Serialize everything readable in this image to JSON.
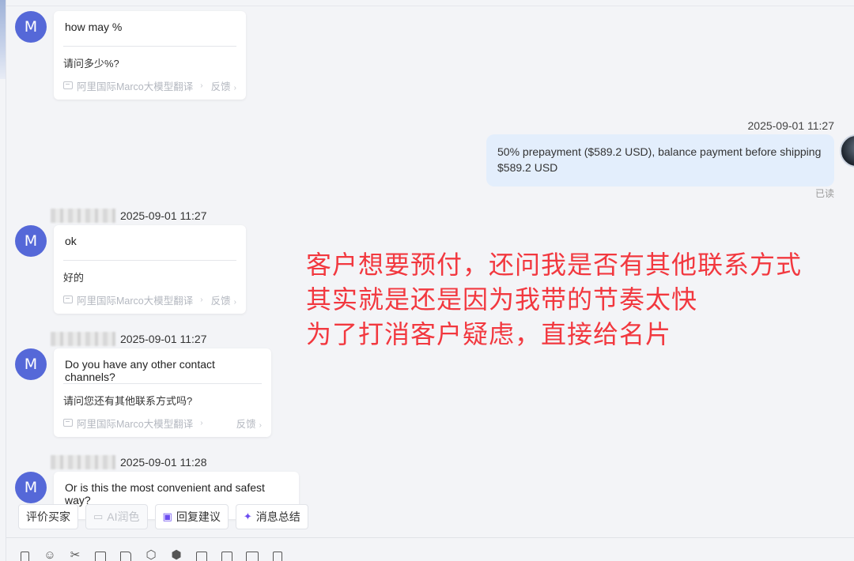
{
  "messages_in": [
    {
      "avatar": "M",
      "original": "how may %",
      "translation": "请问多少%?",
      "translator": "阿里国际Marco大模型翻译",
      "feedback": "反馈"
    },
    {
      "avatar": "M",
      "time": "2025-09-01 11:27",
      "original": "ok",
      "translation": "好的",
      "translator": "阿里国际Marco大模型翻译",
      "feedback": "反馈"
    },
    {
      "avatar": "M",
      "time": "2025-09-01 11:27",
      "original": "Do you have any other contact channels?",
      "translation": "请问您还有其他联系方式吗?",
      "translator": "阿里国际Marco大模型翻译",
      "feedback": "反馈"
    },
    {
      "avatar": "M",
      "time": "2025-09-01 11:28",
      "original": "Or is this the most convenient and safest way?"
    }
  ],
  "message_out": {
    "time": "2025-09-01 11:27",
    "text": "50% prepayment ($589.2 USD), balance payment before shipping $589.2 USD",
    "status": "已读"
  },
  "annotation": [
    "客户想要预付，还问我是否有其他联系方式",
    "其实就是还是因为我带的节奏太快",
    "为了打消客户疑虑，直接给名片"
  ],
  "actions": {
    "rate_buyer": "评价买家",
    "ai_polish": "AI润色",
    "reply_suggest": "回复建议",
    "msg_summary": "消息总结"
  },
  "toolbar_icons": [
    "copy-icon",
    "emoji-icon",
    "scissors-icon",
    "image-icon",
    "folder-icon",
    "product-icon",
    "package-icon",
    "calendar-icon",
    "translate-icon",
    "card-icon",
    "note-icon"
  ],
  "colors": {
    "avatar": "#5568d8",
    "annotation": "#f2383f",
    "out_bubble": "#e3eefc",
    "accent": "#6b4cf0"
  }
}
